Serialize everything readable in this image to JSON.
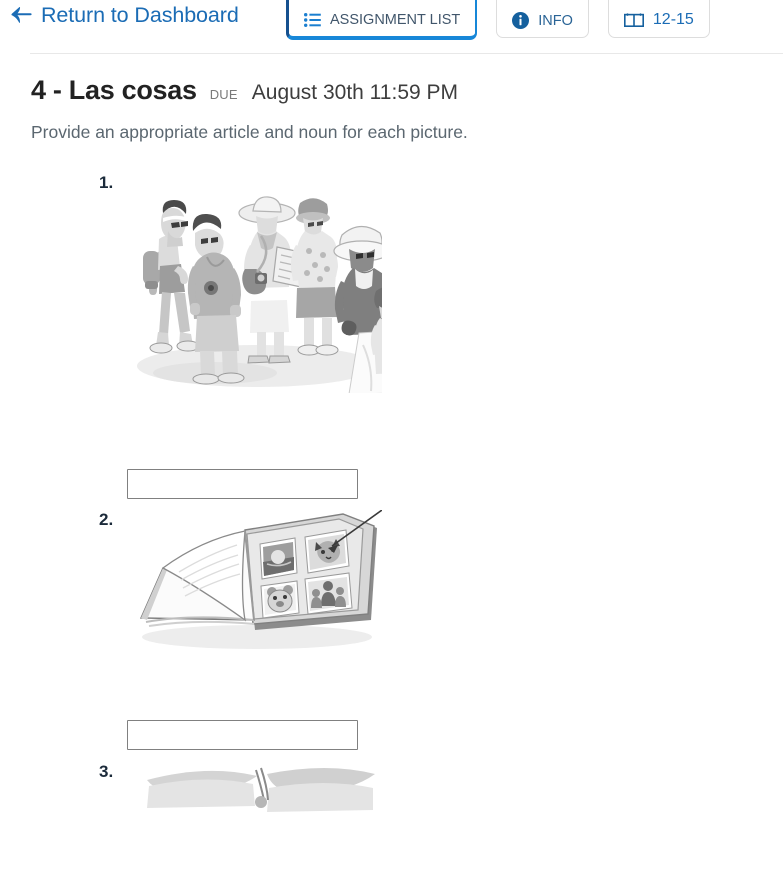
{
  "header": {
    "back_link": {
      "label": "Return to Dashboard",
      "icon": "back-arrow-icon"
    },
    "tabs": [
      {
        "label": "ASSIGNMENT LIST",
        "icon": "list-icon",
        "active": true
      },
      {
        "label": "INFO",
        "icon": "info-circle-icon",
        "active": false
      },
      {
        "label": "12-15",
        "icon": "open-book-icon",
        "active": false
      }
    ]
  },
  "assignment": {
    "title": "4 - Las cosas",
    "due_label": "DUE",
    "due_date": "August 30th 11:59 PM",
    "instructions": "Provide an appropriate article and noun for each picture."
  },
  "questions": [
    {
      "number": "1.",
      "image_alt": "Group of tourists with hats, backpacks and a map",
      "answer_value": "",
      "answer_placeholder": ""
    },
    {
      "number": "2.",
      "image_alt": "Open photo album with four photographs",
      "answer_value": "",
      "answer_placeholder": ""
    },
    {
      "number": "3.",
      "image_alt": "Partially visible illustration",
      "answer_value": "",
      "answer_placeholder": ""
    }
  ],
  "colors": {
    "link_blue": "#1b6cb5",
    "accent_blue": "#1787d8",
    "tab_border_dark": "#15508f",
    "text_dark": "#222222",
    "text_muted": "#5b6770",
    "divider": "#e8e8e8"
  }
}
